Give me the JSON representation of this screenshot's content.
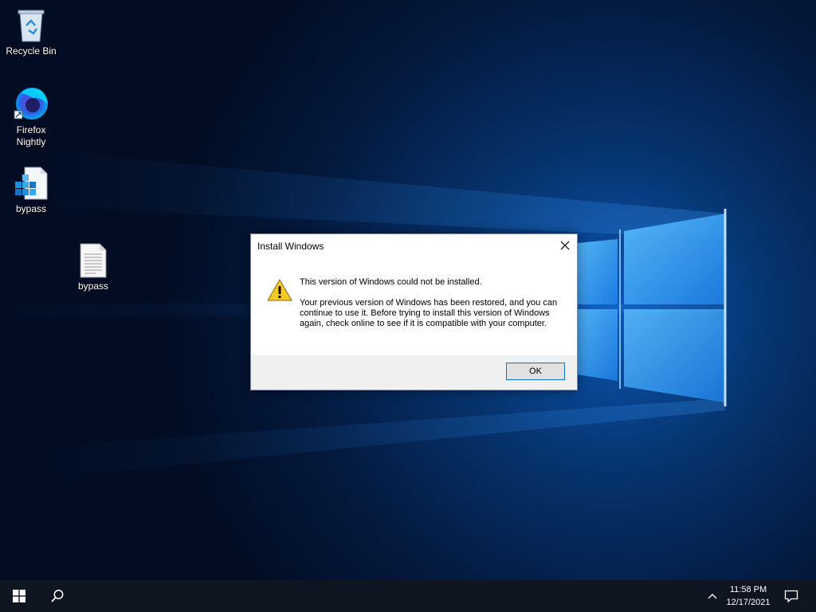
{
  "desktop": {
    "icons": [
      {
        "label": "Recycle Bin",
        "icon": "recycle-bin-icon"
      },
      {
        "label_line1": "Firefox",
        "label_line2": "Nightly",
        "icon": "firefox-nightly-icon"
      },
      {
        "label": "bypass",
        "icon": "registry-file-icon"
      },
      {
        "label": "bypass",
        "icon": "text-file-icon"
      }
    ]
  },
  "dialog": {
    "title": "Install Windows",
    "headline": "This version of Windows could not be installed.",
    "body": "Your previous version of Windows has been restored, and you can continue to use it.  Before trying to install this version of Windows again, check online to see if it is compatible with your computer.",
    "ok_label": "OK",
    "icon": "warning-icon"
  },
  "taskbar": {
    "time": "11:58 PM",
    "date": "12/17/2021",
    "icons": [
      "windows-start-icon",
      "search-icon",
      "chevron-up-icon",
      "notification-icon"
    ]
  },
  "colors": {
    "wallpaper": "#061a3a",
    "taskbar": "#101522",
    "accent": "#0078d7"
  }
}
